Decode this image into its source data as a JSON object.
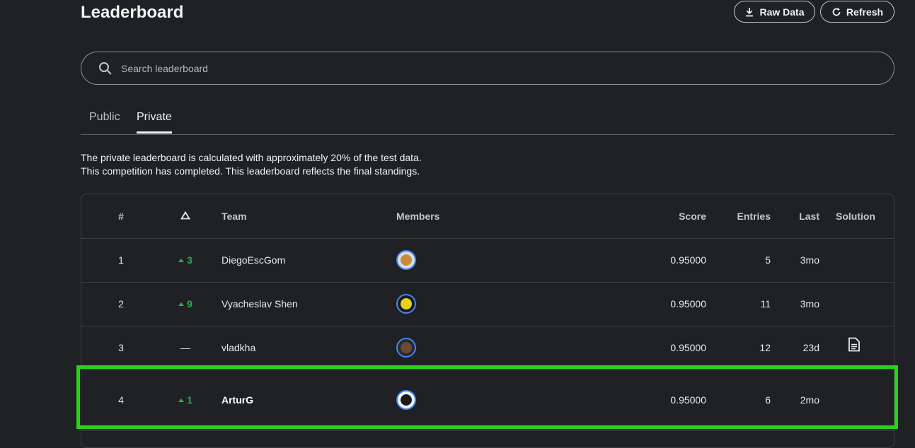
{
  "page": {
    "title": "Leaderboard",
    "raw_data_label": "Raw Data",
    "refresh_label": "Refresh",
    "search_placeholder": "Search leaderboard",
    "tabs": [
      "Public",
      "Private"
    ],
    "active_tab": "Private",
    "description_line1": "The private leaderboard is calculated with approximately 20% of the test data.",
    "description_line2": "This competition has completed. This leaderboard reflects the final standings."
  },
  "table": {
    "headers": {
      "rank": "#",
      "team": "Team",
      "members": "Members",
      "score": "Score",
      "entries": "Entries",
      "last": "Last",
      "solution": "Solution"
    },
    "rows": [
      {
        "rank": "1",
        "delta": "3",
        "delta_type": "up",
        "team": "DiegoEscGom",
        "score": "0.95000",
        "entries": "5",
        "last": "3mo",
        "solution": false,
        "avatar_color": "#c98a3a"
      },
      {
        "rank": "2",
        "delta": "9",
        "delta_type": "up",
        "team": "Vyacheslav Shen",
        "score": "0.95000",
        "entries": "11",
        "last": "3mo",
        "solution": false,
        "avatar_color": "#e6d21b"
      },
      {
        "rank": "3",
        "delta": "—",
        "delta_type": "same",
        "team": "vladkha",
        "score": "0.95000",
        "entries": "12",
        "last": "23d",
        "solution": true,
        "avatar_color": "#6b4a3a"
      },
      {
        "rank": "4",
        "delta": "1",
        "delta_type": "up",
        "team": "ArturG",
        "score": "0.95000",
        "entries": "6",
        "last": "2mo",
        "solution": false,
        "avatar_color": "#1b1b1b",
        "highlighted": true
      }
    ]
  },
  "colors": {
    "highlight": "#2ad21a",
    "up": "#34a853"
  }
}
